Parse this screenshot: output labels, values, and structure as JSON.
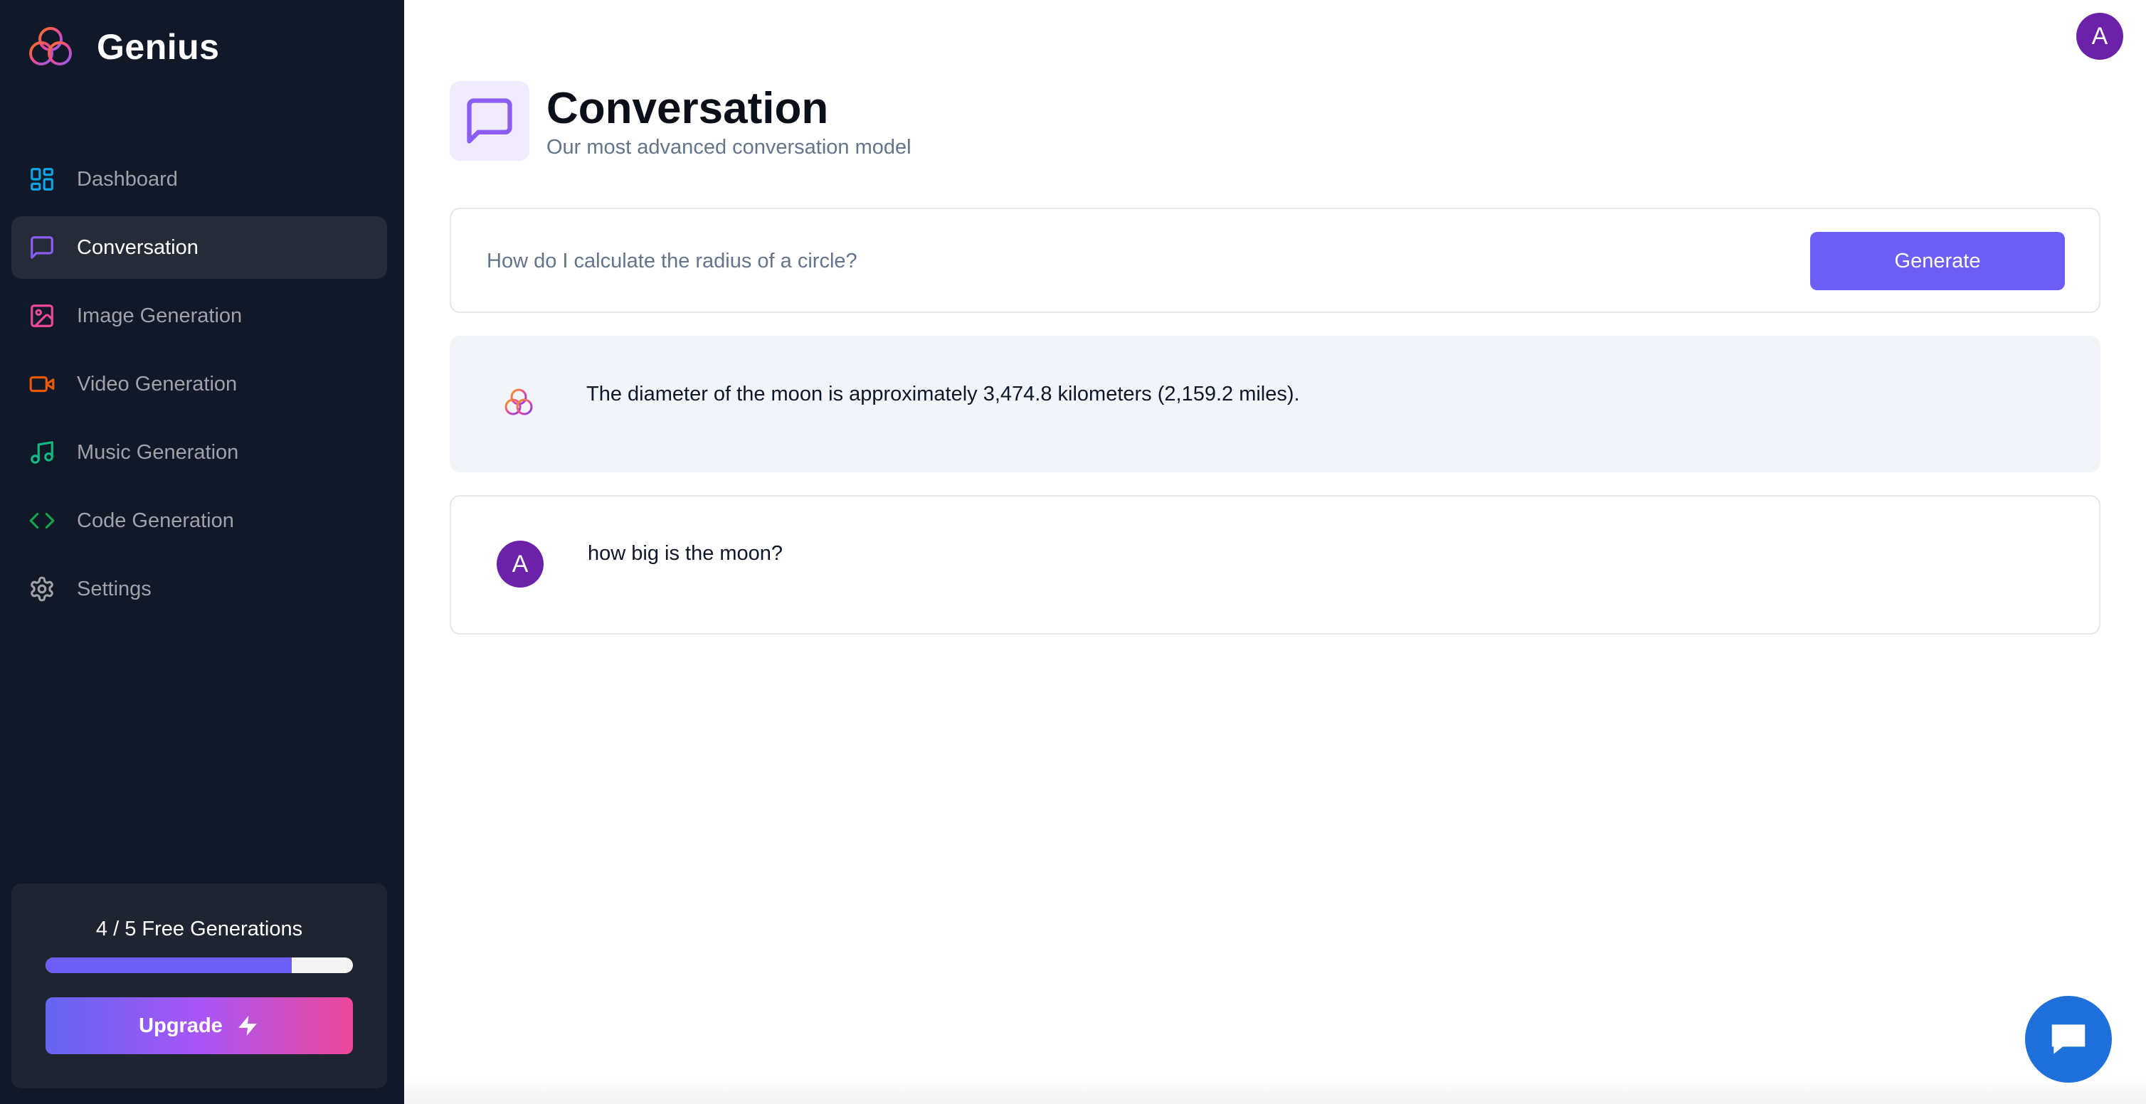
{
  "app": {
    "name": "Genius"
  },
  "sidebar": {
    "items": [
      {
        "label": "Dashboard",
        "icon": "layout-dashboard-icon",
        "color": "#0ea5e9"
      },
      {
        "label": "Conversation",
        "icon": "message-square-icon",
        "color": "#8b5cf6",
        "active": true
      },
      {
        "label": "Image Generation",
        "icon": "image-icon",
        "color": "#ec4899"
      },
      {
        "label": "Video Generation",
        "icon": "video-icon",
        "color": "#ea580c"
      },
      {
        "label": "Music Generation",
        "icon": "music-icon",
        "color": "#10b981"
      },
      {
        "label": "Code Generation",
        "icon": "code-icon",
        "color": "#16a34a"
      },
      {
        "label": "Settings",
        "icon": "settings-icon",
        "color": "#a1a1aa"
      }
    ],
    "limit": {
      "text": "4 / 5 Free Generations",
      "used": 4,
      "total": 5,
      "fraction": 0.8
    },
    "upgrade_label": "Upgrade"
  },
  "header": {
    "avatar_letter": "A"
  },
  "page": {
    "title": "Conversation",
    "subtitle": "Our most advanced conversation model"
  },
  "prompt": {
    "placeholder": "How do I calculate the radius of a circle?",
    "value": "",
    "generate_label": "Generate"
  },
  "messages": [
    {
      "role": "bot",
      "text": "The diameter of the moon is approximately 3,474.8 kilometers (2,159.2 miles)."
    },
    {
      "role": "user",
      "avatar_letter": "A",
      "text": "how big is the moon?"
    }
  ],
  "colors": {
    "accent": "#6d5ff5",
    "sidebar_bg": "#111827",
    "user_avatar": "#6b21a8",
    "chat_fab": "#1e6fd9"
  }
}
